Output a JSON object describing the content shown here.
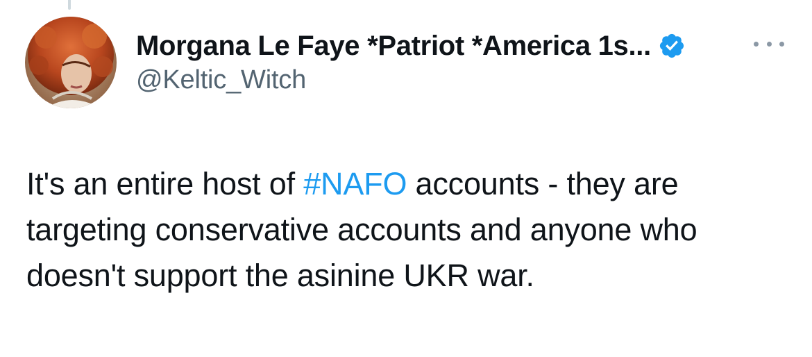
{
  "author": {
    "display_name": "Morgana Le Faye *Patriot *America 1s...",
    "handle": "@Keltic_Witch",
    "verified": true,
    "avatar_icon": "profile-photo-red-hair-woman"
  },
  "tweet": {
    "text_before": "It's an entire host of ",
    "hashtag": "#NAFO",
    "text_after": " accounts - they are targeting conservative accounts and anyone who doesn't support the asinine UKR war."
  },
  "colors": {
    "text": "#0f1419",
    "secondary": "#536471",
    "link": "#1d9bf0",
    "verified": "#1d9bf0"
  }
}
